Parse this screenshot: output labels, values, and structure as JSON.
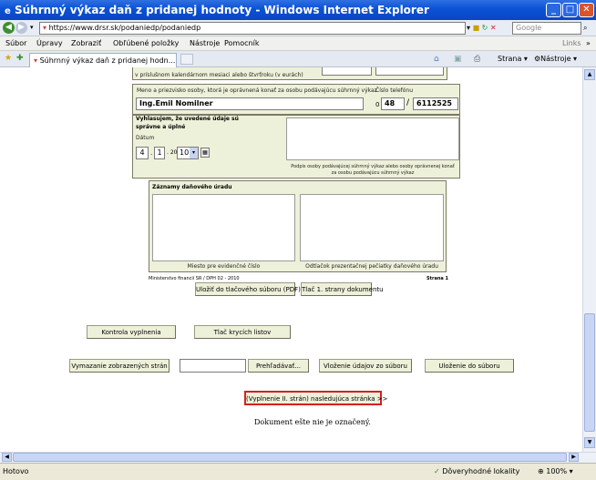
{
  "window": {
    "title": "Súhrnný výkaz daň z pridanej hodnoty - Windows Internet Explorer",
    "min": "_",
    "max": "□",
    "close": "✕"
  },
  "address": {
    "url": "https://www.drsr.sk/podaniedp/podaniedp",
    "search_placeholder": "Google"
  },
  "menu": {
    "items": [
      "Súbor",
      "Úpravy",
      "Zobraziť",
      "Obľúbené položky",
      "Nástroje",
      "Pomocník"
    ],
    "links": "Links",
    "chevron": "»"
  },
  "tabs": {
    "active": "Súhrnný výkaz daň z pridanej hodn...",
    "strana": "Strana",
    "nastroje": "Nástroje"
  },
  "form": {
    "top_label": "v príslušnom kalendárnom mesiaci alebo štvrťroku (v eurách)",
    "name_label": "Meno a priezvisko osoby, ktorá je oprávnená konať za osobu podávajúcu súhrnný výkaz",
    "name_value": "Ing.Emil Nomilner",
    "phone_label": "Číslo telefónu",
    "phone_prefix": "0",
    "phone_area": "48",
    "phone_number": "6112525",
    "declaration_1": "Vyhlasujem, že uvedené údaje sú",
    "declaration_2": "správne a úplné",
    "date_label": "Dátum",
    "date_day": "4",
    "date_month": "1",
    "date_century": "20",
    "date_year": "10",
    "signature_label_1": "Podpis osoby podávajúcej súhrnný výkaz alebo osoby oprávnenej konať",
    "signature_label_2": "za osobu podávajúcu súhrnný výkaz",
    "office_title": "Záznamy daňového úradu",
    "office_left_caption": "Miesto pre evidenčné číslo",
    "office_right_caption": "Odtlačok prezentačnej pečiatky daňového úradu",
    "footer_left": "Ministerstvo financií SR / DPH 02 - 2010",
    "footer_right": "Strana 1"
  },
  "buttons": {
    "save_pdf": "Uložiť do tlačového súboru (PDF)",
    "print_page": "Tlač 1. strany dokumentu",
    "check": "Kontrola vyplnenia",
    "print_cover": "Tlač krycích listov",
    "clear": "Vymazanie zobrazených strán",
    "browse": "Prehľadávať...",
    "load": "Vloženie údajov zo súboru",
    "save_file": "Uloženie do súboru",
    "next": "(Vyplnenie II. strán) nasledujúca stránka >>"
  },
  "notice": "Dokument ešte nie je označený.",
  "status": {
    "left": "Hotovo",
    "zone": "Dôveryhodné lokality",
    "zoom": "100%"
  }
}
